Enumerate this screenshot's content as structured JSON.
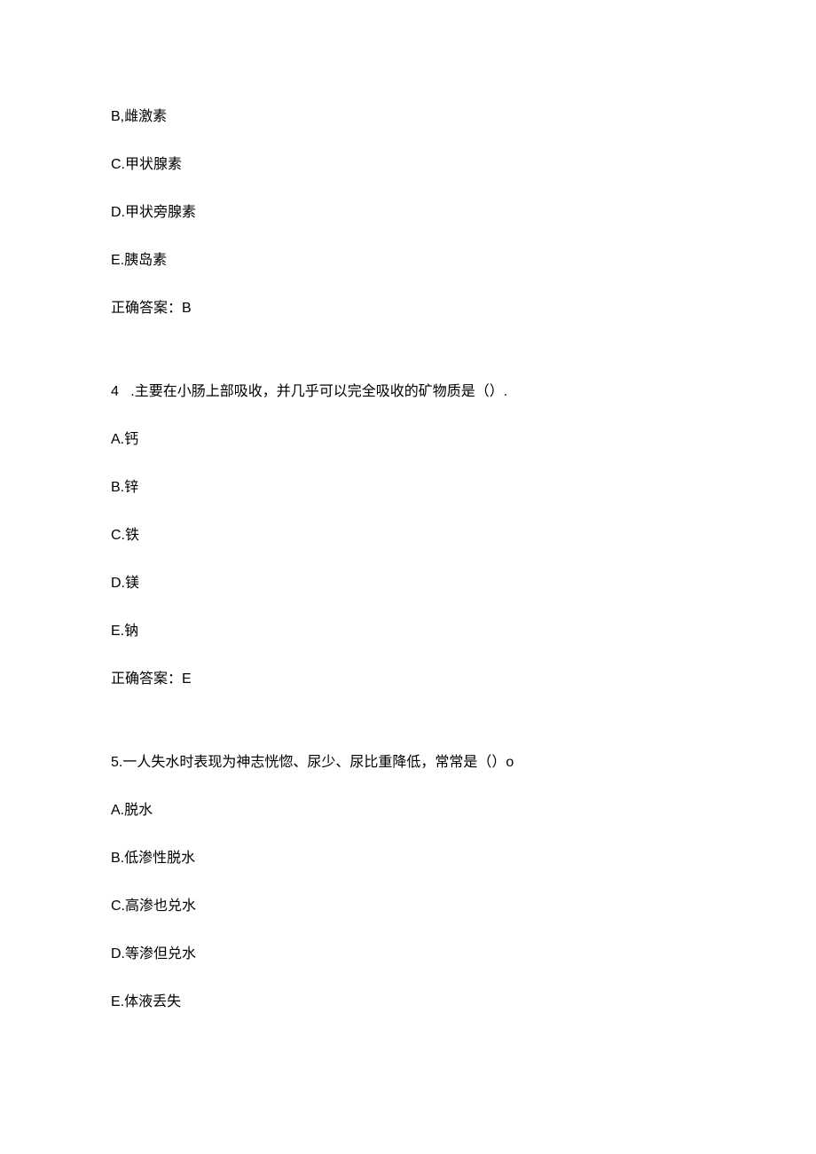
{
  "q3_continued": {
    "options": [
      {
        "label": "B,雌激素"
      },
      {
        "label": "C.甲状腺素"
      },
      {
        "label": "D.甲状旁腺素"
      },
      {
        "label": "E.胰岛素"
      }
    ],
    "answer": "正确答案：B"
  },
  "q4": {
    "number": "4",
    "stem": ".主要在小肠上部吸收，并几乎可以完全吸收的矿物质是（）.",
    "options": [
      {
        "label": "A.钙"
      },
      {
        "label": "B.锌"
      },
      {
        "label": "C.铁"
      },
      {
        "label": "D.镁"
      },
      {
        "label": "E.钠"
      }
    ],
    "answer": "正确答案：E"
  },
  "q5": {
    "stem": "5.一人失水时表现为神志恍惚、尿少、尿比重降低，常常是（）o",
    "options": [
      {
        "label": "A.脱水"
      },
      {
        "label": "B.低渗性脱水"
      },
      {
        "label": "C.高渗也兑水"
      },
      {
        "label": "D.等渗但兑水"
      },
      {
        "label": "E.体液丢失"
      }
    ]
  }
}
